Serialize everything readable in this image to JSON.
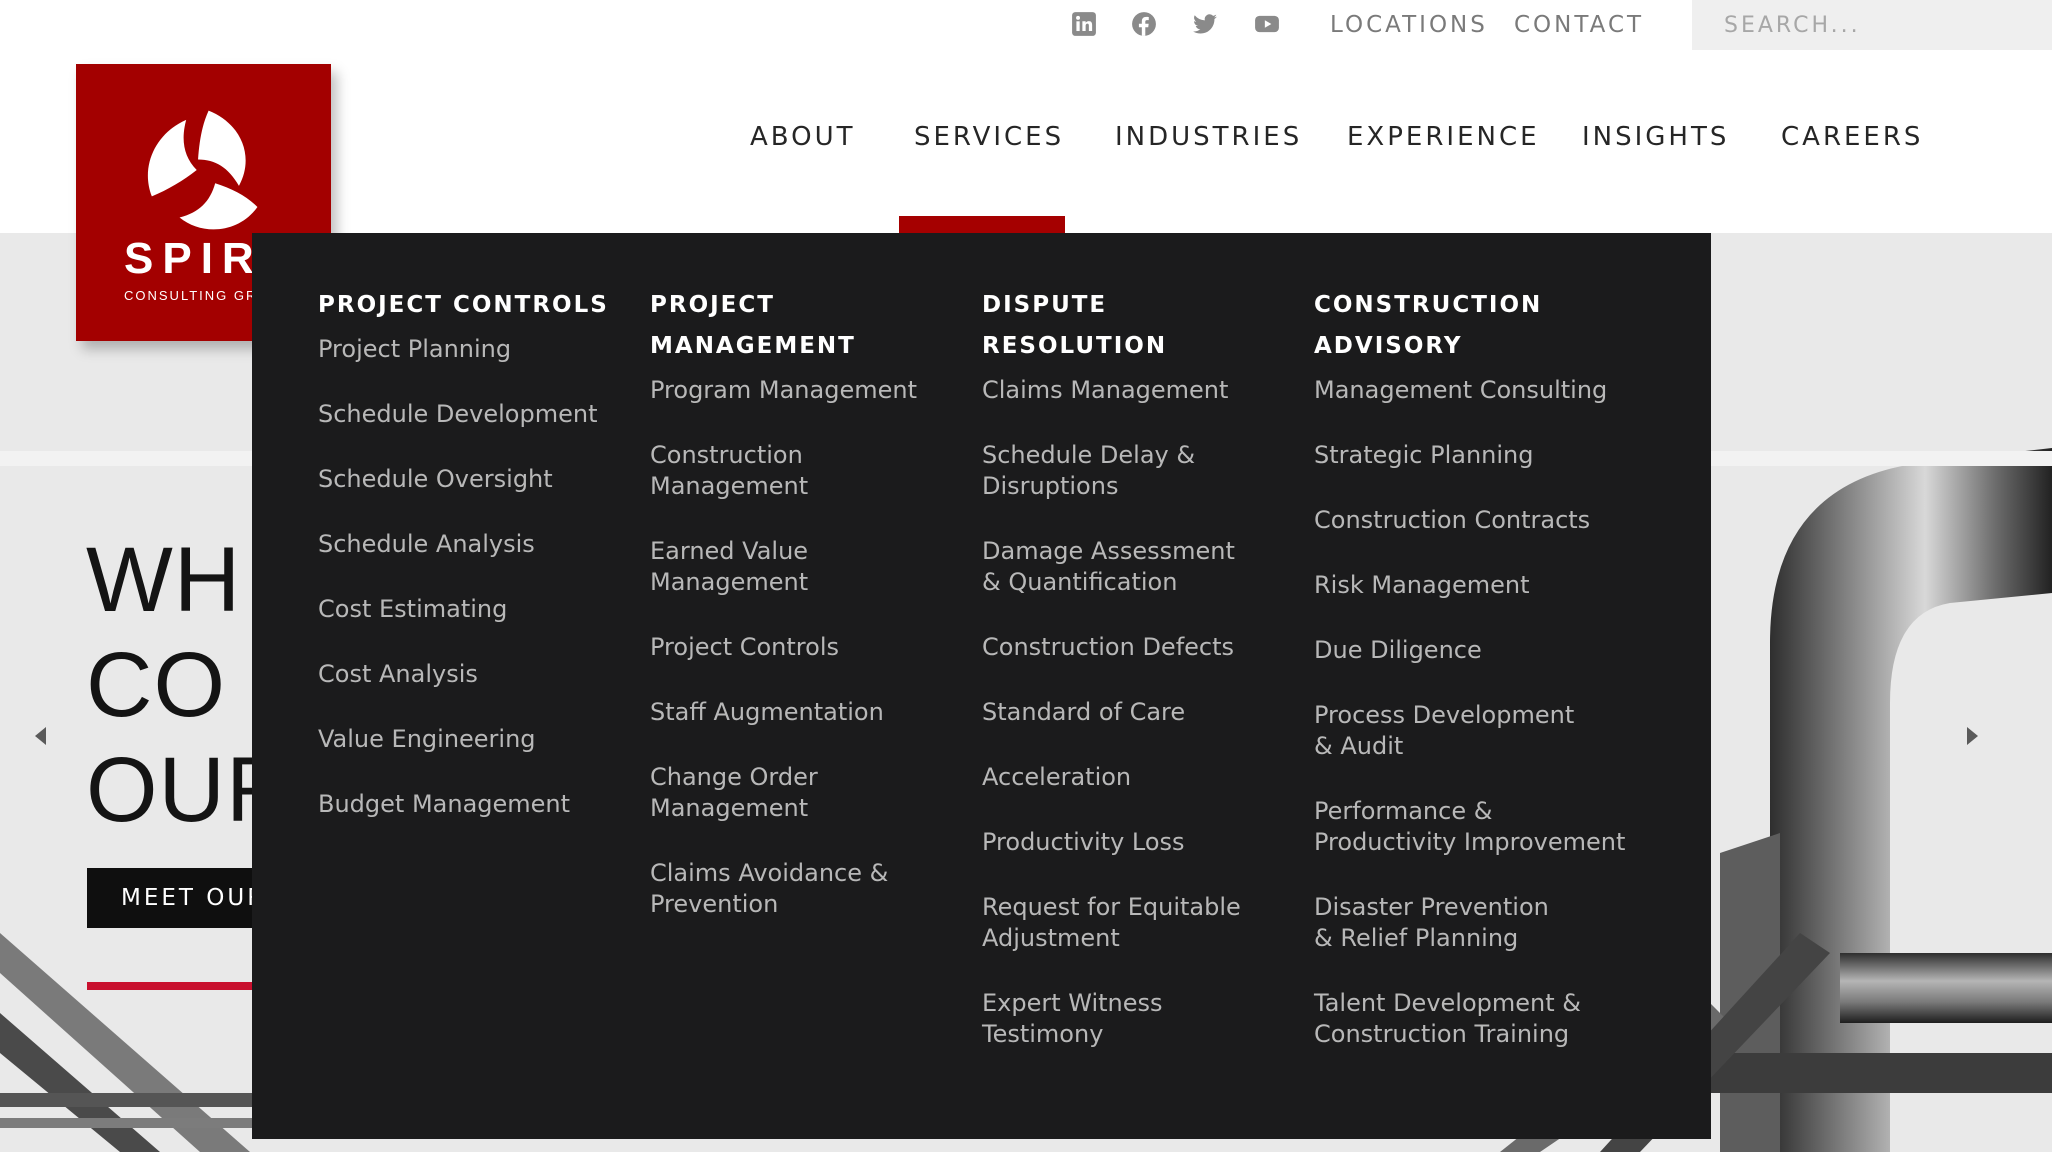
{
  "utility": {
    "social": [
      "linkedin-icon",
      "facebook-icon",
      "twitter-icon",
      "youtube-icon"
    ],
    "locations_label": "LOCATIONS",
    "contact_label": "CONTACT",
    "search_placeholder": "SEARCH..."
  },
  "logo": {
    "name": "SPIR",
    "sub": "CONSULTING GR"
  },
  "nav": {
    "items": [
      "ABOUT",
      "SERVICES",
      "INDUSTRIES",
      "EXPERIENCE",
      "INSIGHTS",
      "CAREERS"
    ],
    "active": "SERVICES"
  },
  "hero": {
    "lines": [
      "WH",
      "CO",
      "OUR"
    ],
    "button_label": "MEET OUR"
  },
  "menu": {
    "columns": [
      {
        "heading": [
          "PROJECT CONTROLS"
        ],
        "items": [
          "Project Planning",
          "Schedule Development",
          "Schedule Oversight",
          "Schedule Analysis",
          "Cost Estimating",
          "Cost Analysis",
          "Value Engineering",
          "Budget Management"
        ]
      },
      {
        "heading": [
          "PROJECT",
          "MANAGEMENT"
        ],
        "items": [
          "Program Management",
          "Construction Management",
          "Earned Value Management",
          "Project Controls",
          "Staff Augmentation",
          "Change Order Management",
          "Claims Avoidance & Prevention"
        ]
      },
      {
        "heading": [
          "DISPUTE RESOLUTION"
        ],
        "items": [
          "Claims Management",
          "Schedule Delay & Disruptions",
          "Damage Assessment & Quantification",
          "Construction Defects",
          "Standard of Care",
          "Acceleration",
          "Productivity Loss",
          "Request for Equitable Adjustment",
          "Expert Witness Testimony"
        ]
      },
      {
        "heading": [
          "CONSTRUCTION",
          "ADVISORY"
        ],
        "items": [
          "Management Consulting",
          "Strategic Planning",
          "Construction Contracts",
          "Risk Management",
          "Due Diligence",
          "Process Development & Audit",
          "Performance & Productivity Improvement",
          "Disaster Prevention & Relief Planning",
          "Talent Development & Construction Training"
        ]
      }
    ]
  },
  "colors": {
    "brand_red": "#a30000",
    "menu_bg": "#1b1b1c",
    "menu_text": "#b8b8b8"
  }
}
